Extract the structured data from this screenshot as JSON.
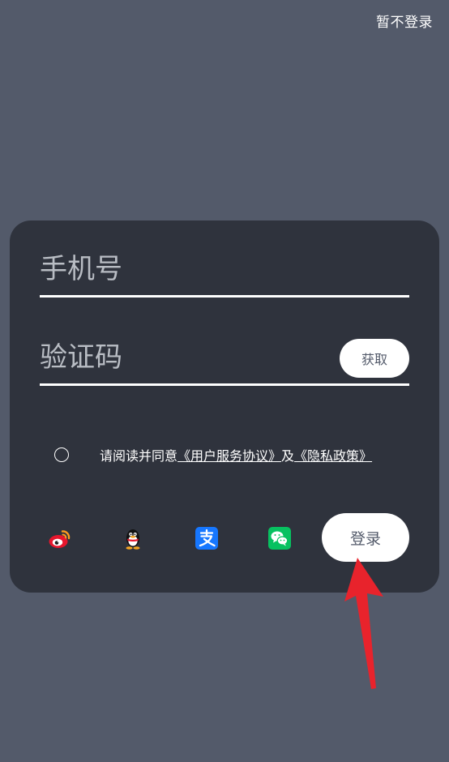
{
  "colors": {
    "background": "#535a6a",
    "card": "#2f333d",
    "text_dark": "#535a6a",
    "arrow": "#e8232c"
  },
  "header": {
    "skip_label": "暂不登录"
  },
  "form": {
    "phone_placeholder": "手机号",
    "code_placeholder": "验证码",
    "get_code_label": "获取"
  },
  "agreement": {
    "prefix": "请阅读并同意",
    "terms_link": "《用户服务协议》",
    "conjunction": "及",
    "privacy_link": "《隐私政策》"
  },
  "social_logins": [
    {
      "icon": "weibo-icon"
    },
    {
      "icon": "qq-icon"
    },
    {
      "icon": "alipay-icon"
    },
    {
      "icon": "wechat-icon"
    }
  ],
  "login_label": "登录",
  "annotation": {
    "icon": "red-arrow-icon"
  }
}
